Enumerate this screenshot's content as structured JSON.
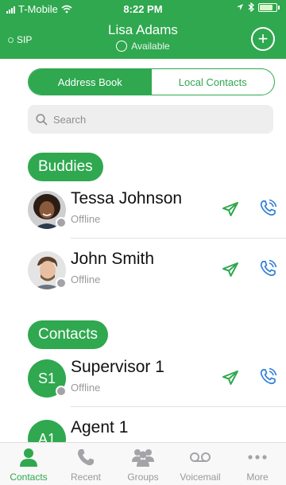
{
  "status_bar": {
    "carrier": "T-Mobile",
    "time": "8:22 PM"
  },
  "header": {
    "sip_label": "SIP",
    "user_name": "Lisa Adams",
    "presence": "Available"
  },
  "tabs_top": [
    {
      "label": "Address Book",
      "active": true
    },
    {
      "label": "Local Contacts",
      "active": false
    }
  ],
  "search": {
    "placeholder": "Search"
  },
  "sections": {
    "buddies": "Buddies",
    "contacts": "Contacts"
  },
  "buddies": [
    {
      "name": "Tessa Johnson",
      "status": "Offline",
      "avatar": "photo-woman"
    },
    {
      "name": "John Smith",
      "status": "Offline",
      "avatar": "photo-man"
    }
  ],
  "contacts": [
    {
      "name": "Supervisor 1",
      "status": "Offline",
      "initials": "S1"
    },
    {
      "name": "Agent 1",
      "status": "",
      "initials": "A1"
    }
  ],
  "tab_bar": [
    {
      "label": "Contacts",
      "icon": "person-icon",
      "active": true
    },
    {
      "label": "Recent",
      "icon": "phone-icon",
      "active": false
    },
    {
      "label": "Groups",
      "icon": "groups-icon",
      "active": false
    },
    {
      "label": "Voicemail",
      "icon": "voicemail-icon",
      "active": false
    },
    {
      "label": "More",
      "icon": "more-icon",
      "active": false
    }
  ],
  "colors": {
    "accent": "#2fa84f",
    "offline": "#a4a4a8",
    "call_icon": "#2f7fd6"
  }
}
